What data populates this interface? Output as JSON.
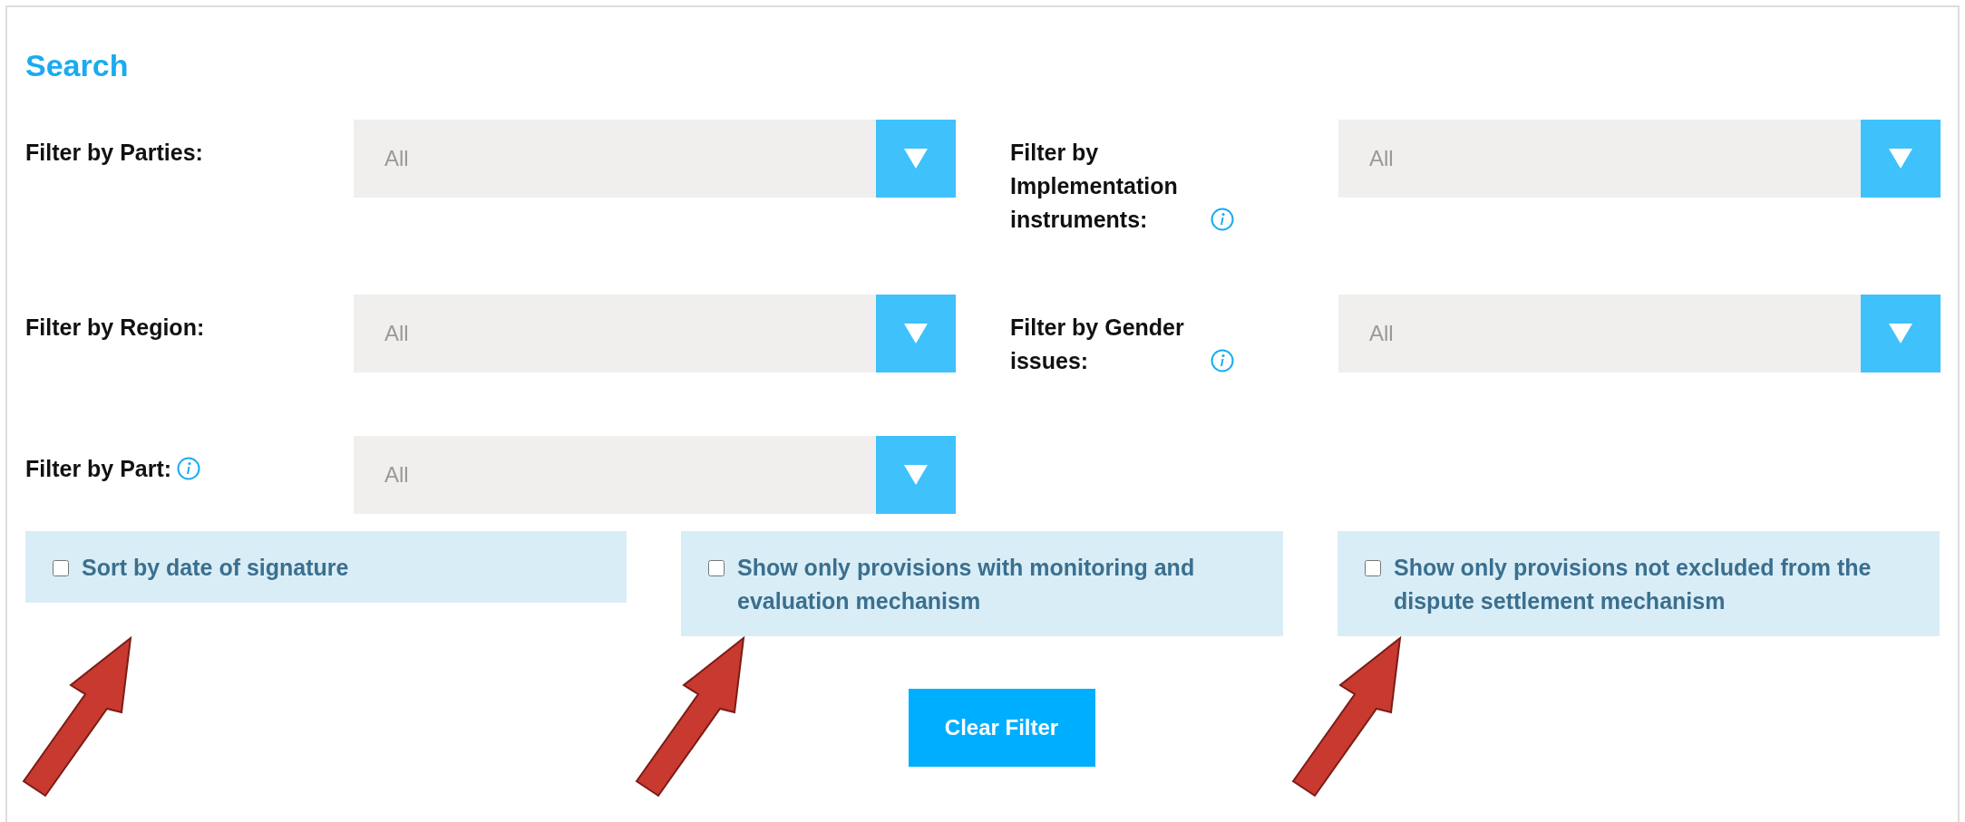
{
  "title": "Search",
  "filter_rows": [
    [
      {
        "label": "Filter by Parties:",
        "info": false,
        "value": "All"
      },
      {
        "label": "Filter by Implementation instruments:",
        "info": true,
        "value": "All"
      }
    ],
    [
      {
        "label": "Filter by Region:",
        "info": false,
        "value": "All"
      },
      {
        "label": "Filter by Gender issues:",
        "info": true,
        "value": "All"
      }
    ],
    [
      {
        "label": "Filter by Part:",
        "info": true,
        "value": "All"
      }
    ]
  ],
  "options": [
    {
      "label": "Sort by date of signature",
      "checked": false
    },
    {
      "label": "Show only provisions with monitoring and evaluation mechanism",
      "checked": false
    },
    {
      "label": "Show only provisions not excluded from the dispute settlement mechanism",
      "checked": false
    }
  ],
  "clear_button": "Clear Filter"
}
